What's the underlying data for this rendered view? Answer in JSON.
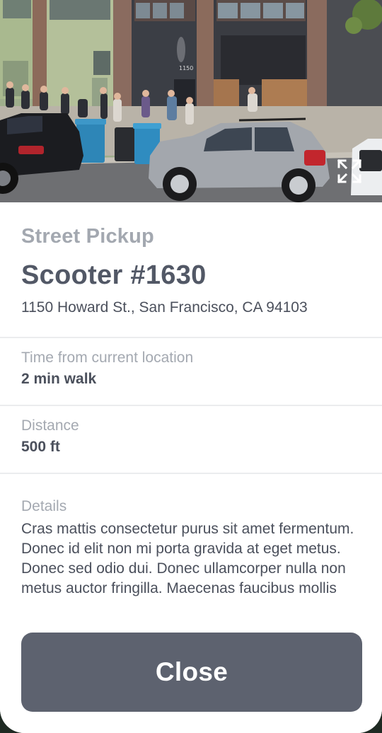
{
  "photo": {
    "building_number": "1150",
    "expand_icon": "expand-arrows-icon"
  },
  "header": {
    "kicker": "Street Pickup",
    "title": "Scooter #1630",
    "address": "1150 Howard St., San Francisco, CA 94103"
  },
  "fields": {
    "time_label": "Time from current location",
    "time_value": "2 min walk",
    "distance_label": "Distance",
    "distance_value": "500 ft",
    "details_label": "Details",
    "details_text": "Cras mattis consectetur purus sit amet fermentum. Donec id elit non mi porta gravida at eget metus. Donec sed odio dui. Donec ullamcorper nulla non metus auctor fringilla. Maecenas faucibus mollis"
  },
  "actions": {
    "close_label": "Close"
  },
  "colors": {
    "primary_button": "#5d626f",
    "muted_text": "#a3a8b0",
    "body_text": "#4b505c"
  }
}
